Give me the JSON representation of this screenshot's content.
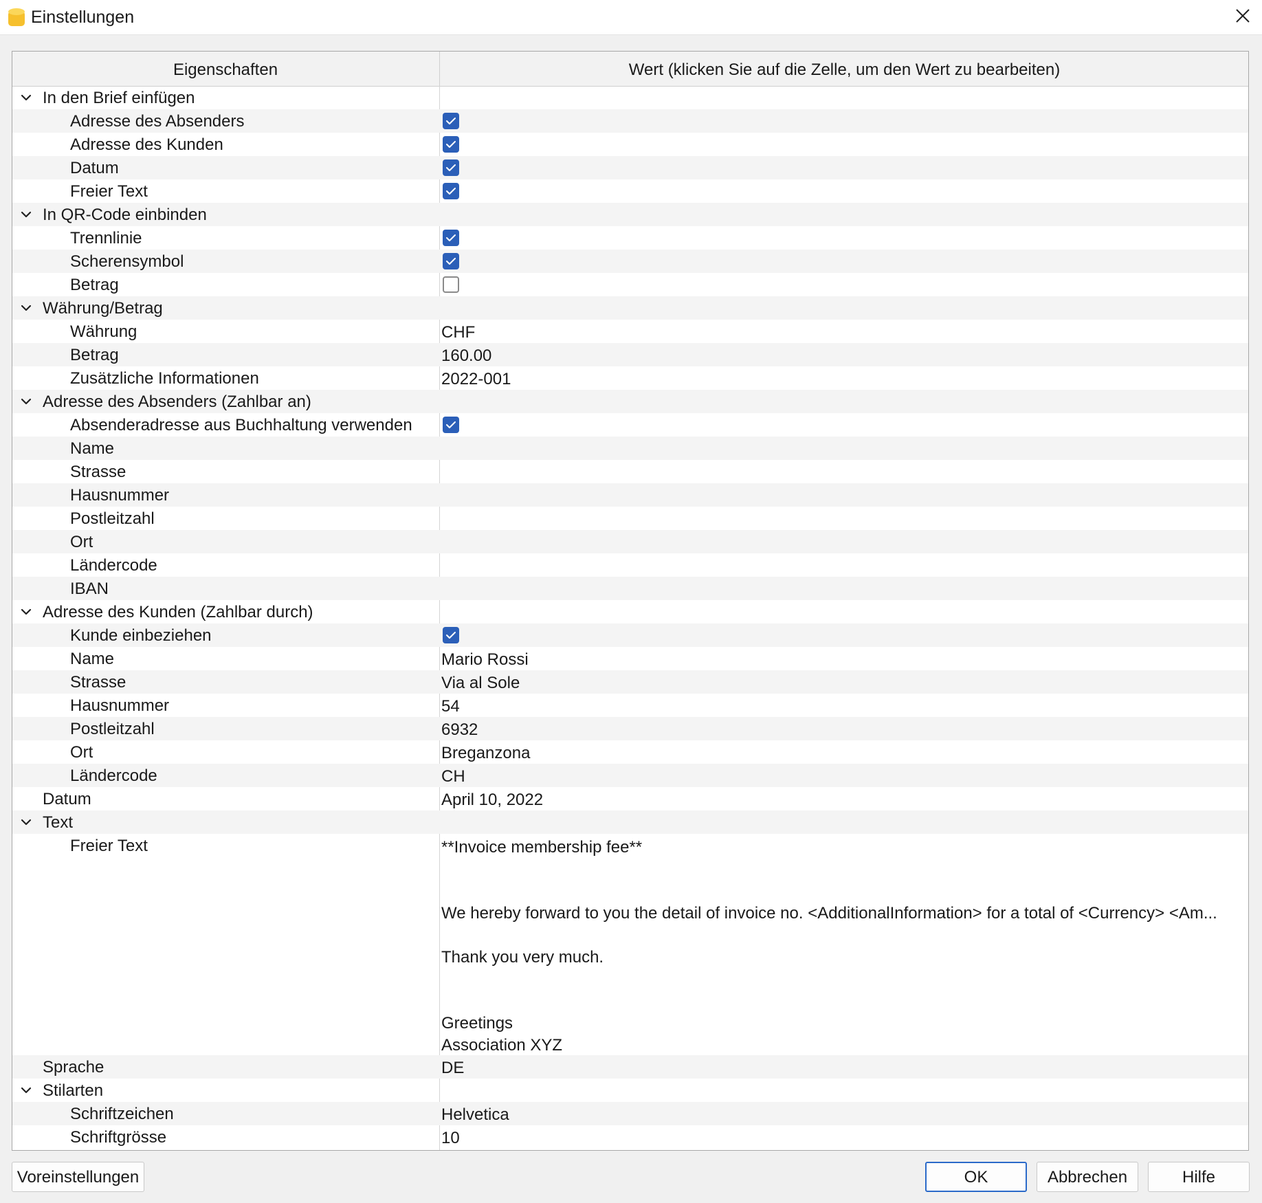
{
  "window": {
    "title": "Einstellungen",
    "app_icon": "app-coin-icon",
    "close_icon": "close-icon",
    "accent_color": "#2b5fb8"
  },
  "grid": {
    "columns": [
      "Eigenschaften",
      "Wert (klicken Sie auf die Zelle, um den Wert zu bearbeiten)"
    ],
    "rows": [
      {
        "label": "In den Brief einfügen",
        "level": 0,
        "group": true
      },
      {
        "label": "Adresse des Absenders",
        "level": 1,
        "checkbox": true,
        "checked": true
      },
      {
        "label": "Adresse des Kunden",
        "level": 1,
        "checkbox": true,
        "checked": true
      },
      {
        "label": "Datum",
        "level": 1,
        "checkbox": true,
        "checked": true
      },
      {
        "label": "Freier Text",
        "level": 1,
        "checkbox": true,
        "checked": true
      },
      {
        "label": "In QR-Code einbinden",
        "level": 0,
        "group": true
      },
      {
        "label": "Trennlinie",
        "level": 1,
        "checkbox": true,
        "checked": true
      },
      {
        "label": "Scherensymbol",
        "level": 1,
        "checkbox": true,
        "checked": true
      },
      {
        "label": "Betrag",
        "level": 1,
        "checkbox": true,
        "checked": false
      },
      {
        "label": "Währung/Betrag",
        "level": 0,
        "group": true
      },
      {
        "label": "Währung",
        "level": 1,
        "value": "CHF"
      },
      {
        "label": "Betrag",
        "level": 1,
        "value": "160.00"
      },
      {
        "label": "Zusätzliche Informationen",
        "level": 1,
        "value": "2022-001"
      },
      {
        "label": "Adresse des Absenders (Zahlbar an)",
        "level": 0,
        "group": true
      },
      {
        "label": "Absenderadresse aus Buchhaltung verwenden",
        "level": 1,
        "checkbox": true,
        "checked": true
      },
      {
        "label": "Name",
        "level": 1,
        "value": ""
      },
      {
        "label": "Strasse",
        "level": 1,
        "value": ""
      },
      {
        "label": "Hausnummer",
        "level": 1,
        "value": ""
      },
      {
        "label": "Postleitzahl",
        "level": 1,
        "value": ""
      },
      {
        "label": "Ort",
        "level": 1,
        "value": ""
      },
      {
        "label": "Ländercode",
        "level": 1,
        "value": ""
      },
      {
        "label": "IBAN",
        "level": 1,
        "value": ""
      },
      {
        "label": "Adresse des Kunden (Zahlbar durch)",
        "level": 0,
        "group": true
      },
      {
        "label": "Kunde einbeziehen",
        "level": 1,
        "checkbox": true,
        "checked": true
      },
      {
        "label": "Name",
        "level": 1,
        "value": "Mario Rossi"
      },
      {
        "label": "Strasse",
        "level": 1,
        "value": "Via al Sole"
      },
      {
        "label": "Hausnummer",
        "level": 1,
        "value": "54"
      },
      {
        "label": "Postleitzahl",
        "level": 1,
        "value": "6932"
      },
      {
        "label": "Ort",
        "level": 1,
        "value": "Breganzona"
      },
      {
        "label": "Ländercode",
        "level": 1,
        "value": "CH"
      },
      {
        "label": "Datum",
        "level": 0,
        "value": "April 10, 2022"
      },
      {
        "label": "Text",
        "level": 0,
        "group": true
      },
      {
        "label": "Freier Text",
        "level": 1,
        "multiline": [
          "**Invoice membership fee**",
          "",
          "",
          "We hereby forward to you the detail of invoice no. <AdditionalInformation> for a total of <Currency> <Am...",
          "",
          "Thank you very much.",
          "",
          "",
          "Greetings",
          "Association XYZ"
        ]
      },
      {
        "label": "Sprache",
        "level": 0,
        "value": "DE"
      },
      {
        "label": "Stilarten",
        "level": 0,
        "group": true
      },
      {
        "label": "Schriftzeichen",
        "level": 1,
        "value": "Helvetica"
      },
      {
        "label": "Schriftgrösse",
        "level": 1,
        "value": "10"
      }
    ]
  },
  "buttons": {
    "defaults": "Voreinstellungen",
    "ok": "OK",
    "cancel": "Abbrechen",
    "help": "Hilfe"
  }
}
